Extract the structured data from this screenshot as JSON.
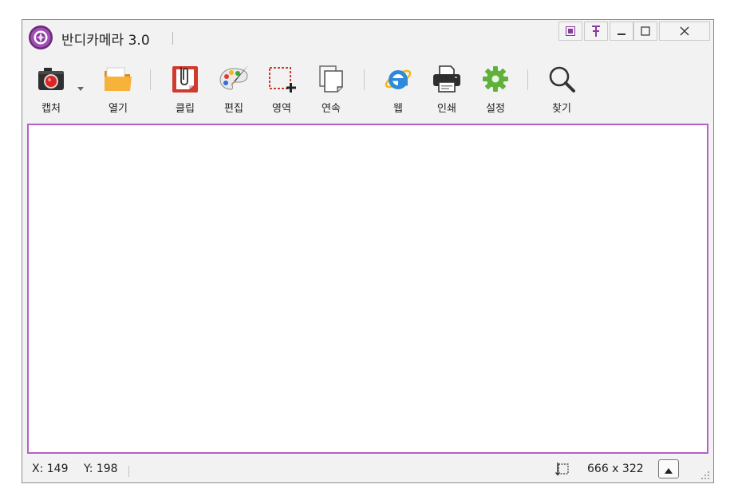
{
  "window": {
    "title": "반디카메라 3.0"
  },
  "toolbar": {
    "items": [
      {
        "label": "캡처",
        "icon": "camera-icon"
      },
      {
        "label": "열기",
        "icon": "folder-icon"
      },
      {
        "label": "클립",
        "icon": "clip-icon"
      },
      {
        "label": "편집",
        "icon": "palette-icon"
      },
      {
        "label": "영역",
        "icon": "region-select-icon"
      },
      {
        "label": "연속",
        "icon": "continuous-pages-icon"
      },
      {
        "label": "웹",
        "icon": "internet-explorer-icon"
      },
      {
        "label": "인쇄",
        "icon": "printer-icon"
      },
      {
        "label": "설정",
        "icon": "gear-icon"
      },
      {
        "label": "찾기",
        "icon": "magnifier-icon"
      }
    ]
  },
  "status": {
    "x_label": "X: 149",
    "y_label": "Y: 198",
    "size": "666 x 322"
  },
  "colors": {
    "accent": "#b062c8",
    "window_bg": "#f2f2f2",
    "gear": "#5fb13c",
    "ie_blue": "#2e8ad8",
    "folder": "#f3a32a",
    "clip_red": "#d13a2f"
  }
}
